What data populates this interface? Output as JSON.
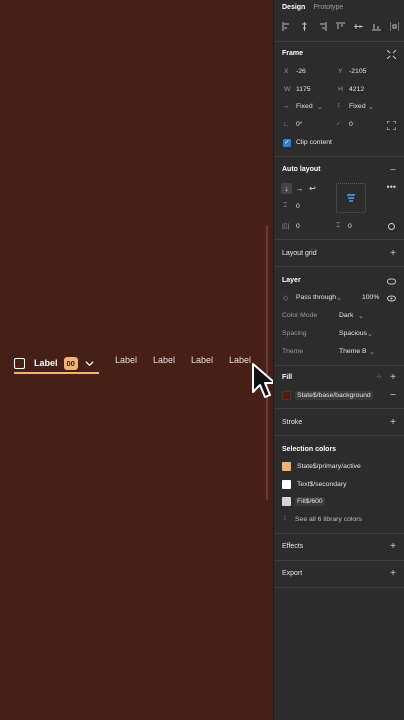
{
  "canvas": {
    "background": "#461f17",
    "tabs": {
      "active": {
        "label": "Label",
        "badge": "00"
      },
      "others": [
        "Label",
        "Label",
        "Label",
        "Label"
      ]
    },
    "accent": "#f0b470"
  },
  "panel": {
    "tabs": {
      "design": "Design",
      "prototype": "Prototype"
    },
    "frame": {
      "title": "Frame",
      "x_label": "X",
      "x": "-26",
      "y_label": "Y",
      "y": "-2105",
      "w_label": "W",
      "w": "1175",
      "h_label": "H",
      "h": "4212",
      "h_resize": "Fixed",
      "v_resize": "Fixed",
      "rotation": "0°",
      "radius": "0",
      "clip": "Clip content"
    },
    "auto_layout": {
      "title": "Auto layout",
      "gap": "0",
      "padding_h": "0",
      "padding_v": "0"
    },
    "layout_grid": {
      "title": "Layout grid"
    },
    "layer": {
      "title": "Layer",
      "blend": "Pass through",
      "opacity": "100%",
      "color_mode_label": "Color Mode",
      "color_mode": "Dark",
      "spacing_label": "Spacing",
      "spacing": "Spacious",
      "theme_label": "Theme",
      "theme": "Theme B"
    },
    "fill": {
      "title": "Fill",
      "value": "State$/base/background",
      "color": "#461f17"
    },
    "stroke": {
      "title": "Stroke"
    },
    "selection_colors": {
      "title": "Selection colors",
      "items": [
        {
          "name": "State$/primary/active",
          "color": "#f0b470"
        },
        {
          "name": "Text$/secondary",
          "color": "#ffffff"
        },
        {
          "name": "Fill$/600",
          "color": "#d4d4d4"
        }
      ],
      "see_all": "See all 6 library colors"
    },
    "effects": {
      "title": "Effects"
    },
    "export": {
      "title": "Export"
    }
  }
}
